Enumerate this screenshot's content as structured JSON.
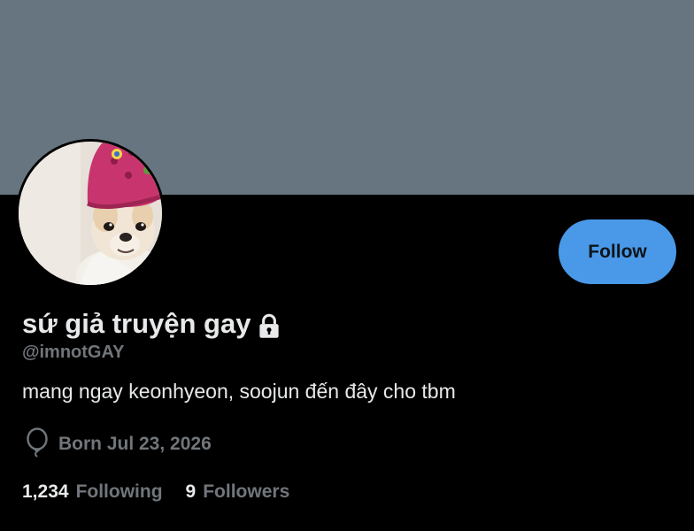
{
  "profile": {
    "display_name": "sứ giả truyện gay",
    "handle": "@imnotGAY",
    "bio": "mang ngay keonhyeon, soojun đến đây cho tbm",
    "protected_icon": "lock-icon",
    "avatar_description_icon": "avatar"
  },
  "actions": {
    "follow_label": "Follow"
  },
  "details": {
    "birthday_icon": "balloon-icon",
    "birthday_text": "Born Jul 23, 2026"
  },
  "stats": {
    "following_count": "1,234",
    "following_label": "Following",
    "followers_count": "9",
    "followers_label": "Followers"
  },
  "colors": {
    "banner": "#66757f",
    "background": "#000000",
    "follow_button": "#4a99e9",
    "primary_text": "#e7e9ea",
    "secondary_text": "#71767b"
  }
}
